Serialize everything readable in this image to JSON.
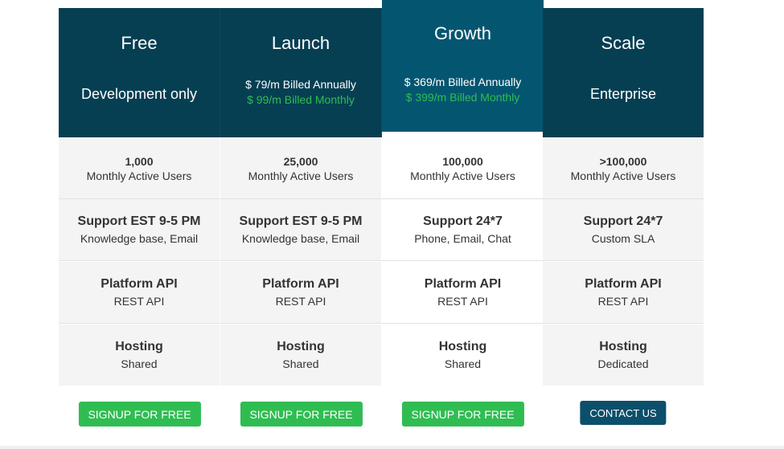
{
  "plans": [
    {
      "name": "Free",
      "subtitle": "Development only",
      "users_value": "1,000",
      "users_label": "Monthly Active Users",
      "support_title": "Support EST 9-5 PM",
      "support_detail": "Knowledge base, Email",
      "api_title": "Platform API",
      "api_detail": "REST API",
      "hosting_title": "Hosting",
      "hosting_detail": "Shared",
      "cta_label": "SIGNUP FOR FREE"
    },
    {
      "name": "Launch",
      "price_annual": "$ 79/m Billed Annually",
      "price_monthly": "$ 99/m Billed Monthly",
      "users_value": "25,000",
      "users_label": "Monthly Active Users",
      "support_title": "Support EST 9-5 PM",
      "support_detail": "Knowledge base, Email",
      "api_title": "Platform API",
      "api_detail": "REST API",
      "hosting_title": "Hosting",
      "hosting_detail": "Shared",
      "cta_label": "SIGNUP FOR FREE"
    },
    {
      "name": "Growth",
      "price_annual": "$ 369/m Billed Annually",
      "price_monthly": "$ 399/m Billed Monthly",
      "users_value": "100,000",
      "users_label": "Monthly Active Users",
      "support_title": "Support 24*7",
      "support_detail": "Phone, Email, Chat",
      "api_title": "Platform API",
      "api_detail": "REST API",
      "hosting_title": "Hosting",
      "hosting_detail": "Shared",
      "cta_label": "SIGNUP FOR FREE"
    },
    {
      "name": "Scale",
      "subtitle": "Enterprise",
      "users_value": ">100,000",
      "users_label": "Monthly Active Users",
      "support_title": "Support 24*7",
      "support_detail": "Custom SLA",
      "api_title": "Platform API",
      "api_detail": "REST API",
      "hosting_title": "Hosting",
      "hosting_detail": "Dedicated",
      "cta_label": "CONTACT US"
    }
  ],
  "colors": {
    "header_bg": "#063f52",
    "featured_header_bg": "#045670",
    "price_green": "#2fbd52",
    "signup_button": "#2fbd52",
    "contact_button": "#0c4f6a",
    "row_bg": "#f4f4f4"
  }
}
